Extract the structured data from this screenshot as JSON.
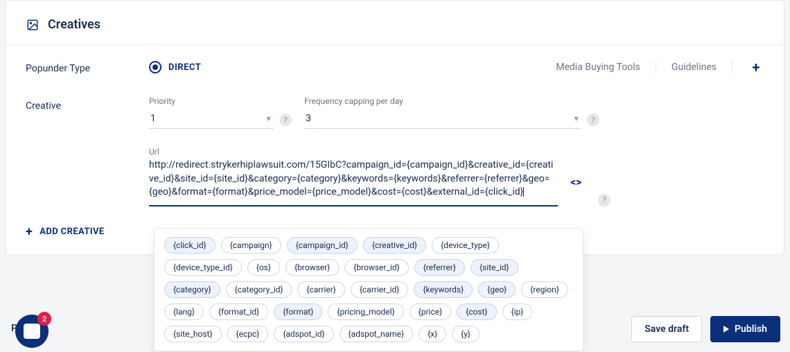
{
  "header": {
    "title": "Creatives"
  },
  "popunder": {
    "label": "Popunder Type",
    "option": "DIRECT",
    "links": {
      "media": "Media Buying Tools",
      "guidelines": "Guidelines"
    }
  },
  "creative": {
    "label": "Creative",
    "priority": {
      "label": "Priority",
      "value": "1"
    },
    "freq": {
      "label": "Frequency capping per day",
      "value": "3"
    },
    "url": {
      "label": "Url",
      "value": "http://redirect.strykerhiplawsuit.com/15GIbC?campaign_id={campaign_id}&creative_id={creative_id}&site_id={site_id}&category={category}&keywords={keywords}&referrer={referrer}&geo={geo}&format={format}&price_model={price_model}&cost={cost}&external_id={click_id}"
    }
  },
  "tags": [
    {
      "t": "{click_id}",
      "a": true
    },
    {
      "t": "{campaign}",
      "a": false
    },
    {
      "t": "{campaign_id}",
      "a": true
    },
    {
      "t": "{creative_id}",
      "a": true
    },
    {
      "t": "{device_type}",
      "a": false
    },
    {
      "t": "{device_type_id}",
      "a": false
    },
    {
      "t": "{os}",
      "a": false
    },
    {
      "t": "{browser}",
      "a": false
    },
    {
      "t": "{browser_id}",
      "a": false
    },
    {
      "t": "{referrer}",
      "a": true
    },
    {
      "t": "{site_id}",
      "a": true
    },
    {
      "t": "{category}",
      "a": true
    },
    {
      "t": "{category_id}",
      "a": false
    },
    {
      "t": "{carrier}",
      "a": false
    },
    {
      "t": "{carrier_id}",
      "a": false
    },
    {
      "t": "{keywords}",
      "a": true
    },
    {
      "t": "{geo}",
      "a": true
    },
    {
      "t": "{region}",
      "a": false
    },
    {
      "t": "{lang}",
      "a": false
    },
    {
      "t": "{format_id}",
      "a": false
    },
    {
      "t": "{format}",
      "a": true
    },
    {
      "t": "{pricing_model}",
      "a": false
    },
    {
      "t": "{price}",
      "a": false
    },
    {
      "t": "{cost}",
      "a": true
    },
    {
      "t": "{ip}",
      "a": false
    },
    {
      "t": "{site_host}",
      "a": false
    },
    {
      "t": "{ecpc}",
      "a": false
    },
    {
      "t": "{adspot_id}",
      "a": false
    },
    {
      "t": "{adspot_name}",
      "a": false
    },
    {
      "t": "{x}",
      "a": false
    },
    {
      "t": "{y}",
      "a": false
    }
  ],
  "actions": {
    "add_creative": "ADD CREATIVE",
    "save_draft": "Save draft",
    "publish": "Publish"
  },
  "chat": {
    "badge": "2"
  },
  "preview": "Preview"
}
